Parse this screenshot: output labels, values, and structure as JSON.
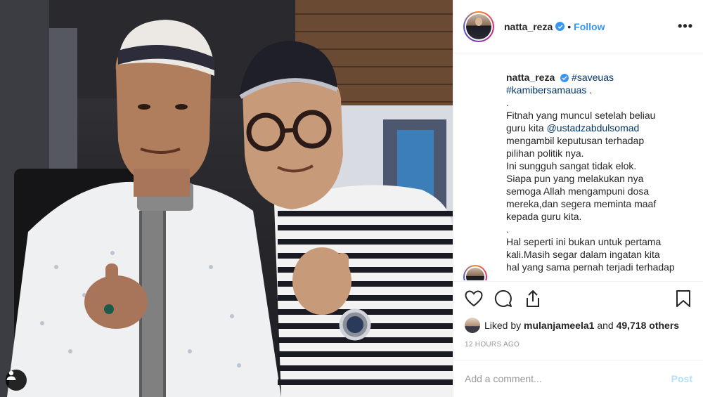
{
  "post": {
    "author": "natta_reza",
    "follow_label": "Follow",
    "separator": "•",
    "more_label": "•••"
  },
  "caption": {
    "author": "natta_reza",
    "lines": [
      {
        "text": "#saveuas"
      },
      {
        "text": "#kamibersamauas ."
      },
      {
        "text": "."
      },
      {
        "text": "Fitnah yang muncul setelah beliau"
      },
      {
        "text_before": "guru kita ",
        "mention": "@ustadzabdulsomad"
      },
      {
        "text": "mengambil keputusan terhadap"
      },
      {
        "text": "pilihan politik nya."
      },
      {
        "text": "Ini sungguh sangat tidak elok."
      },
      {
        "text": "Siapa pun yang melakukan nya"
      },
      {
        "text": "semoga Allah mengampuni dosa"
      },
      {
        "text": "mereka,dan segera meminta maaf"
      },
      {
        "text": "kepada guru kita."
      },
      {
        "text": "."
      },
      {
        "text": "Hal seperti ini bukan untuk pertama"
      },
      {
        "text": "kali.Masih segar dalam ingatan kita"
      },
      {
        "text": "hal yang sama pernah terjadi terhadap"
      }
    ]
  },
  "actions": {
    "like_icon": "heart-icon",
    "comment_icon": "comment-icon",
    "share_icon": "share-icon",
    "save_icon": "bookmark-icon"
  },
  "likes": {
    "prefix": "Liked by",
    "user": "mulanjameela1",
    "middle": "and",
    "others": "49,718 others"
  },
  "timestamp": "12 HOURS AGO",
  "comment_box": {
    "placeholder": "Add a comment...",
    "post_label": "Post"
  },
  "colors": {
    "link": "#003569",
    "follow": "#3897f0",
    "verified": "#3897f0",
    "post_disabled": "#b2dffc"
  }
}
